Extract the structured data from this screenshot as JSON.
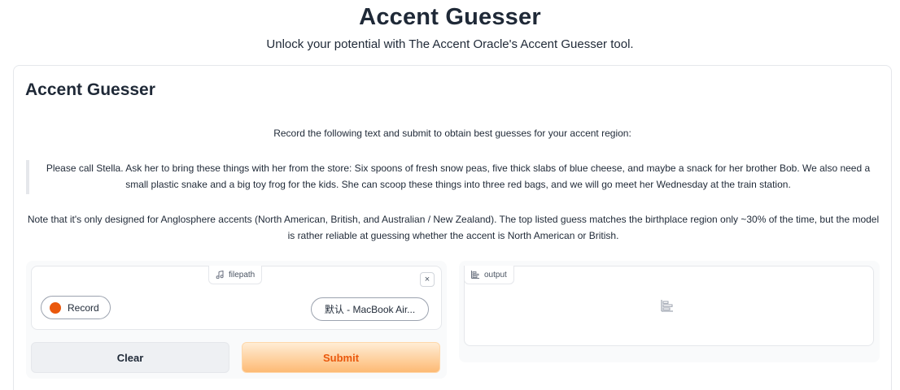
{
  "header": {
    "title": "Accent Guesser",
    "subtitle": "Unlock your potential with The Accent Oracle's Accent Guesser tool."
  },
  "card": {
    "heading": "Accent Guesser",
    "instruction": "Record the following text and submit to obtain best guesses for your accent region:",
    "passage": "Please call Stella. Ask her to bring these things with her from the store: Six spoons of fresh snow peas, five thick slabs of blue cheese, and maybe a snack for her brother Bob. We also need a small plastic snake and a big toy frog for the kids. She can scoop these things into three red bags, and we will go meet her Wednesday at the train station.",
    "note": "Note that it's only designed for Anglosphere accents (North American, British, and Australian / New Zealand). The top listed guess matches the birthplace region only ~30% of the time, but the model is rather reliable at guessing whether the accent is North American or British."
  },
  "audio_input": {
    "label": "filepath",
    "label_icon": "music-note-icon",
    "close_symbol": "×",
    "record_label": "Record",
    "device_value": "默认 - MacBook Air..."
  },
  "actions": {
    "clear_label": "Clear",
    "submit_label": "Submit"
  },
  "output": {
    "label": "output",
    "label_icon": "bar-chart-icon",
    "placeholder_icon": "bar-chart-icon"
  },
  "colors": {
    "accent": "#ea580c",
    "submit_gradient_top": "#ffedd5",
    "submit_gradient_bottom": "#fdba74",
    "border": "#e5e7eb"
  }
}
